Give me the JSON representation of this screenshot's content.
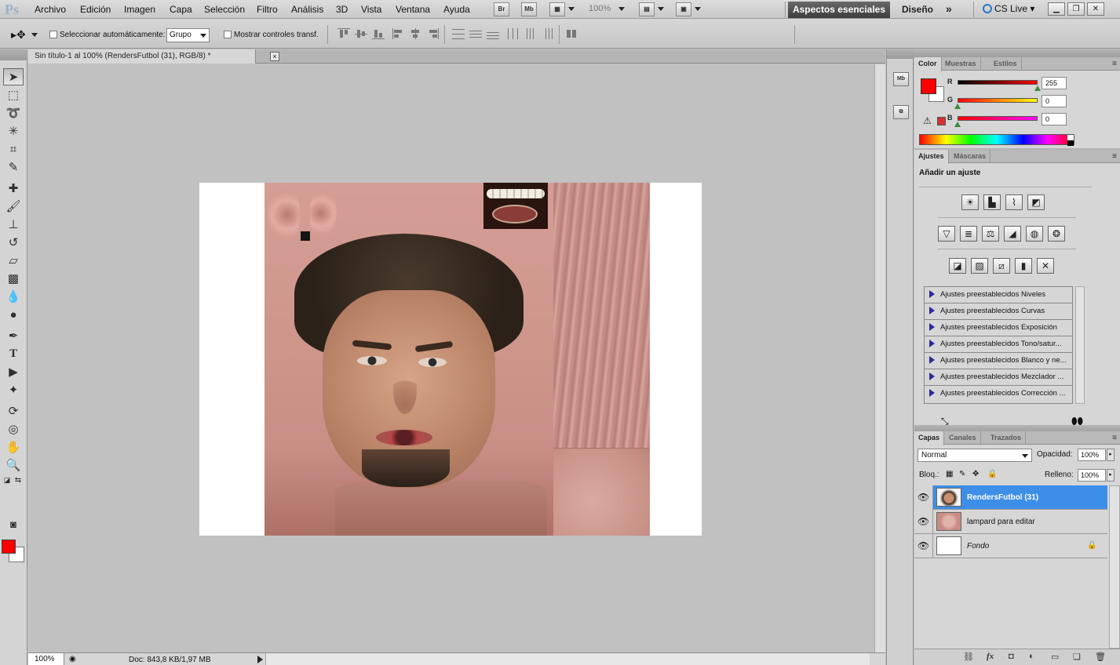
{
  "menubar": {
    "logo": "Ps",
    "items": [
      "Archivo",
      "Edición",
      "Imagen",
      "Capa",
      "Selección",
      "Filtro",
      "Análisis",
      "3D",
      "Vista",
      "Ventana",
      "Ayuda"
    ],
    "bridge": "Br",
    "minibridge": "Mb",
    "zoom": "100%",
    "workspace_active": "Aspectos esenciales",
    "workspace_other": "Diseño",
    "more": "»",
    "cs_live": "CS Live"
  },
  "options": {
    "auto_select_label": "Seleccionar automáticamente:",
    "auto_select_value": "Grupo",
    "show_transform_label": "Mostrar controles transf."
  },
  "document": {
    "tab_title": "Sin título-1 al 100% (RendersFutbol (31), RGB/8) *",
    "close": "×",
    "status_zoom": "100%",
    "status_doc": "Doc: 843,8 KB/1,97 MB"
  },
  "colors": {
    "foreground": "#ff0000",
    "background": "#ffffff",
    "selection": "#3d8ee6"
  },
  "color_panel": {
    "tabs": [
      "Color",
      "Muestras",
      "Estilos"
    ],
    "channels": [
      {
        "label": "R",
        "value": "255",
        "level": 1.0
      },
      {
        "label": "G",
        "value": "0",
        "level": 0.0
      },
      {
        "label": "B",
        "value": "0",
        "level": 0.0
      }
    ]
  },
  "adjust_panel": {
    "tabs": [
      "Ajustes",
      "Máscaras"
    ],
    "title": "Añadir un ajuste",
    "presets": [
      "Ajustes preestablecidos Niveles",
      "Ajustes preestablecidos Curvas",
      "Ajustes preestablecidos Exposición",
      "Ajustes preestablecidos Tono/satur...",
      "Ajustes preestablecidos Blanco y ne...",
      "Ajustes preestablecidos Mezclador ...",
      "Ajustes preestablecidos Corrección ..."
    ]
  },
  "layers_panel": {
    "tabs": [
      "Capas",
      "Canales",
      "Trazados"
    ],
    "blend_mode": "Normal",
    "opacity_label": "Opacidad:",
    "opacity": "100%",
    "lock_label": "Bloq.:",
    "fill_label": "Relleno:",
    "fill": "100%",
    "layers": [
      {
        "name": "RendersFutbol (31)",
        "selected": true
      },
      {
        "name": "lampard para editar",
        "selected": false
      },
      {
        "name": "Fondo",
        "selected": false,
        "locked": true
      }
    ]
  }
}
